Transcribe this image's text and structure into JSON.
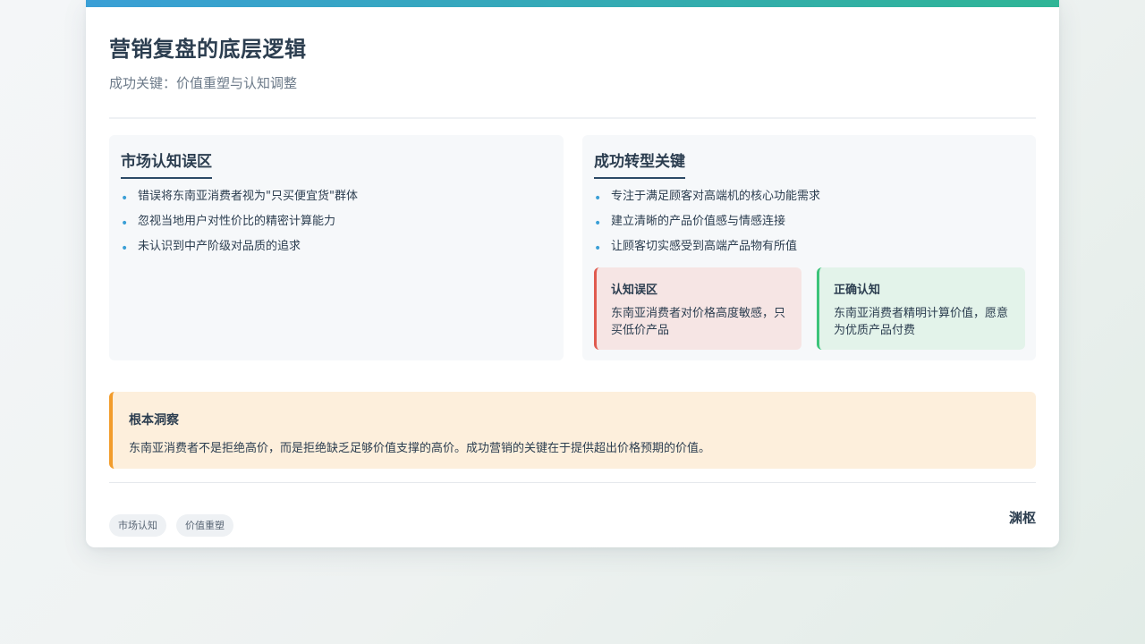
{
  "header": {
    "title": "营销复盘的底层逻辑",
    "subtitle": "成功关键：价值重塑与认知调整"
  },
  "left_panel": {
    "title": "市场认知误区",
    "items": [
      "错误将东南亚消费者视为\"只买便宜货\"群体",
      "忽视当地用户对性价比的精密计算能力",
      "未认识到中产阶级对品质的追求"
    ]
  },
  "right_panel": {
    "title": "成功转型关键",
    "items": [
      "专注于满足顾客对高端机的核心功能需求",
      "建立清晰的产品价值感与情感连接",
      "让顾客切实感受到高端产品物有所值"
    ],
    "wrong": {
      "title": "认知误区",
      "text": "东南亚消费者对价格高度敏感，只买低价产品"
    },
    "correct": {
      "title": "正确认知",
      "text": "东南亚消费者精明计算价值，愿意为优质产品付费"
    }
  },
  "insight": {
    "title": "根本洞察",
    "text": "东南亚消费者不是拒绝高价，而是拒绝缺乏足够价值支撑的高价。成功营销的关键在于提供超出价格预期的价值。"
  },
  "footer": {
    "tags": [
      "市场认知",
      "价值重塑"
    ],
    "brand": "渊枢"
  },
  "icons": {
    "bullet": "bullet-dot-icon"
  },
  "colors": {
    "accent_blue": "#3a9fd6",
    "accent_teal": "#2fb596",
    "wrong_red": "#e05a4f",
    "correct_green": "#3cc47a",
    "insight_orange": "#f29c2b",
    "text_dark": "#2c3e50"
  }
}
